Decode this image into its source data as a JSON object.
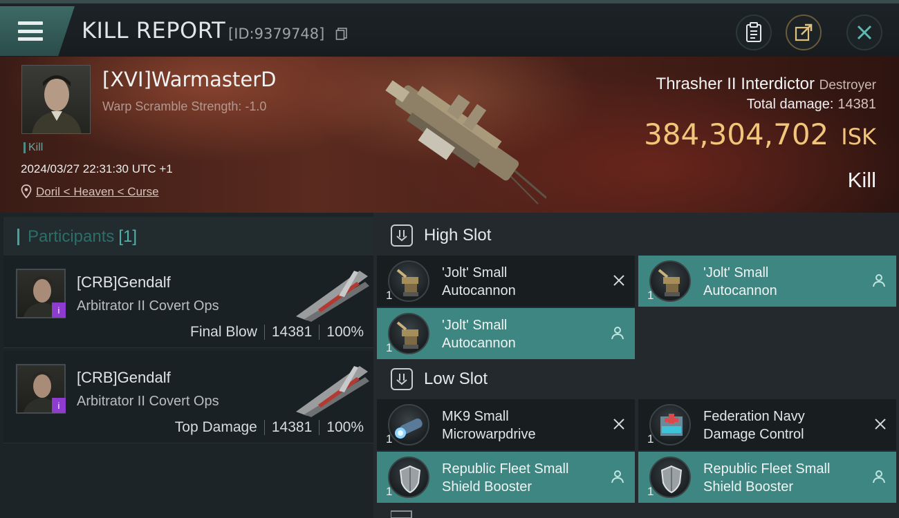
{
  "topbar": {
    "title": "KILL REPORT",
    "id_text": "[ID:9379748]",
    "icons": [
      "menu-icon",
      "copy-icon",
      "clipboard-icon",
      "share-icon",
      "close-icon"
    ]
  },
  "victim": {
    "name": "[XVI]WarmasterD",
    "warp_text": "Warp Scramble Strength: -1.0",
    "tag": "Kill",
    "time": "2024/03/27 22:31:30 UTC +1",
    "location": "Doril < Heaven < Curse",
    "ship": "Thrasher II Interdictor",
    "ship_class": "Destroyer",
    "total_damage_label": "Total damage:",
    "total_damage": "14381",
    "isk_value": "384,304,702",
    "isk_unit": "ISK",
    "result": "Kill"
  },
  "participants": {
    "label": "Participants",
    "count": "[1]",
    "items": [
      {
        "name": "[CRB]Gendalf",
        "ship": "Arbitrator II Covert Ops",
        "role": "Final Blow",
        "damage": "14381",
        "percent": "100%"
      },
      {
        "name": "[CRB]Gendalf",
        "ship": "Arbitrator II Covert Ops",
        "role": "Top Damage",
        "damage": "14381",
        "percent": "100%"
      }
    ]
  },
  "slots": {
    "high": {
      "title": "High Slot",
      "modules": [
        {
          "qty": "1",
          "line1": "'Jolt' Small",
          "line2": "Autocannon",
          "state": "destroyed"
        },
        {
          "qty": "1",
          "line1": "'Jolt' Small",
          "line2": "Autocannon",
          "state": "dropped"
        },
        {
          "qty": "1",
          "line1": "'Jolt' Small",
          "line2": "Autocannon",
          "state": "dropped"
        }
      ]
    },
    "low": {
      "title": "Low Slot",
      "modules": [
        {
          "qty": "1",
          "line1": "MK9 Small",
          "line2": "Microwarpdrive",
          "state": "destroyed"
        },
        {
          "qty": "1",
          "line1": "Federation Navy",
          "line2": "Damage Control",
          "state": "destroyed"
        },
        {
          "qty": "1",
          "line1": "Republic Fleet Small",
          "line2": "Shield Booster",
          "state": "dropped"
        },
        {
          "qty": "1",
          "line1": "Republic Fleet Small",
          "line2": "Shield Booster",
          "state": "dropped"
        }
      ]
    }
  },
  "colors": {
    "accent": "#3e8681",
    "isk": "#f1c67a",
    "badge": "#8e3bd0"
  }
}
